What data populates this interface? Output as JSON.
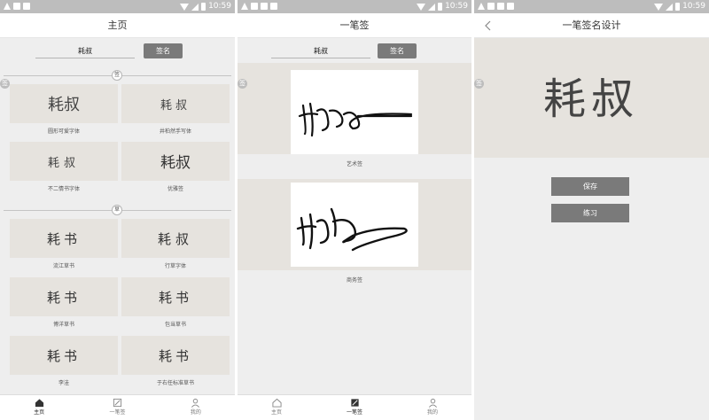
{
  "status_bar": {
    "time": "10:59"
  },
  "screen1": {
    "title": "主页",
    "search": {
      "value": "耗叔",
      "button": "签名"
    },
    "sections": [
      {
        "badge": "签"
      },
      {
        "badge": "草"
      }
    ],
    "side_badge": "签",
    "cards": [
      {
        "name": "圆形可爱字体",
        "text": "耗叔"
      },
      {
        "name": "井柏然手写体",
        "text": "耗叔"
      },
      {
        "name": "不二情书字体",
        "text": "耗叔"
      },
      {
        "name": "优雅签",
        "text": "耗叔"
      },
      {
        "name": "流江草书",
        "text": "耗书"
      },
      {
        "name": "行草字体",
        "text": "耗叔"
      },
      {
        "name": "博洋草书",
        "text": "耗书"
      },
      {
        "name": "包当草书",
        "text": "耗书"
      },
      {
        "name": "李洼",
        "text": "耗书"
      },
      {
        "name": "于右任标准草书",
        "text": "耗书"
      }
    ]
  },
  "screen2": {
    "title": "一笔签",
    "search": {
      "value": "耗叔",
      "button": "签名"
    },
    "side_badge": "签",
    "cards": [
      {
        "name": "艺术签"
      },
      {
        "name": "商务签"
      }
    ]
  },
  "screen3": {
    "title": "一笔签名设计",
    "side_badge": "签",
    "preview_text": "耗叔",
    "buttons": {
      "save": "保存",
      "practice": "练习"
    }
  },
  "tabbar": [
    {
      "label": "主页",
      "icon": "home-icon"
    },
    {
      "label": "一笔签",
      "icon": "pen-icon"
    },
    {
      "label": "我的",
      "icon": "user-icon"
    }
  ],
  "colors": {
    "status_bar": "#bdbdbd",
    "button": "#7a7a7a",
    "paper": "#e6e3de",
    "content_bg": "#eeeeee"
  }
}
